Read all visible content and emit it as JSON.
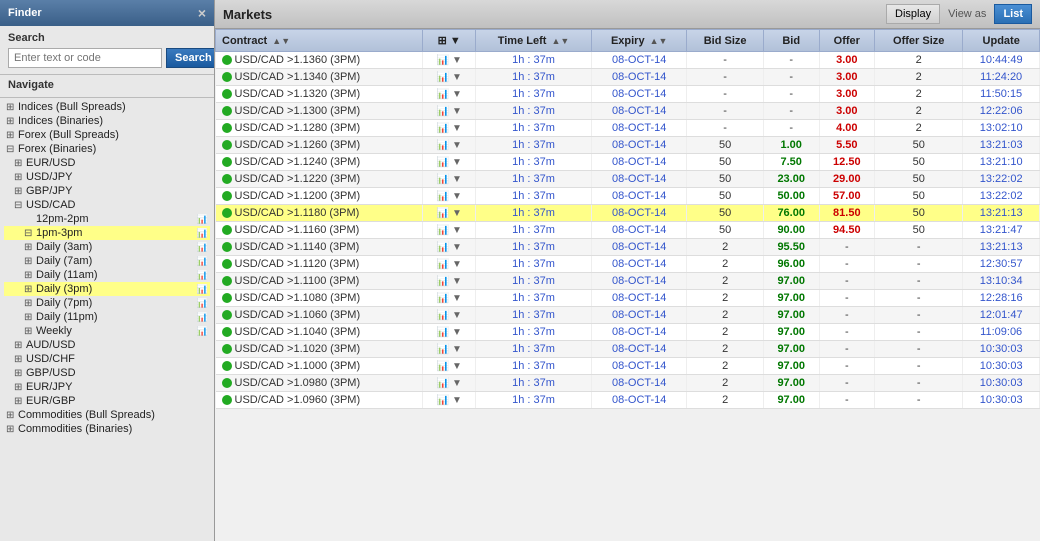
{
  "sidebar": {
    "title": "Finder",
    "close_button": "×",
    "search": {
      "label": "Search",
      "placeholder": "Enter text or code",
      "button_label": "Search"
    },
    "navigate_label": "Navigate",
    "nav_items": [
      {
        "id": "indices-bull",
        "label": "Indices (Bull Spreads)",
        "level": 0,
        "expanded": false,
        "expandable": true
      },
      {
        "id": "indices-bin",
        "label": "Indices (Binaries)",
        "level": 0,
        "expanded": false,
        "expandable": true
      },
      {
        "id": "forex-bull",
        "label": "Forex (Bull Spreads)",
        "level": 0,
        "expanded": false,
        "expandable": true
      },
      {
        "id": "forex-bin",
        "label": "Forex (Binaries)",
        "level": 0,
        "expanded": true,
        "expandable": true
      },
      {
        "id": "eur-usd",
        "label": "EUR/USD",
        "level": 1,
        "expanded": false,
        "expandable": true
      },
      {
        "id": "usd-jpy",
        "label": "USD/JPY",
        "level": 1,
        "expanded": false,
        "expandable": true
      },
      {
        "id": "gbp-jpy",
        "label": "GBP/JPY",
        "level": 1,
        "expanded": false,
        "expandable": true
      },
      {
        "id": "usd-cad",
        "label": "USD/CAD",
        "level": 1,
        "expanded": true,
        "expandable": true
      },
      {
        "id": "12pm-2pm",
        "label": "12pm-2pm",
        "level": 2,
        "expanded": false,
        "expandable": false,
        "has_icon": true
      },
      {
        "id": "1pm-3pm",
        "label": "1pm-3pm",
        "level": 2,
        "expanded": true,
        "expandable": true,
        "has_icon": true,
        "active": true
      },
      {
        "id": "daily-3am",
        "label": "Daily (3am)",
        "level": 2,
        "expanded": false,
        "expandable": true,
        "has_icon": true
      },
      {
        "id": "daily-7am",
        "label": "Daily (7am)",
        "level": 2,
        "expanded": false,
        "expandable": true,
        "has_icon": true
      },
      {
        "id": "daily-11am",
        "label": "Daily (11am)",
        "level": 2,
        "expanded": false,
        "expandable": true,
        "has_icon": true
      },
      {
        "id": "daily-3pm",
        "label": "Daily (3pm)",
        "level": 2,
        "expanded": false,
        "expandable": true,
        "has_icon": true,
        "active": true
      },
      {
        "id": "daily-7pm",
        "label": "Daily (7pm)",
        "level": 2,
        "expanded": false,
        "expandable": true,
        "has_icon": true
      },
      {
        "id": "daily-11pm",
        "label": "Daily (11pm)",
        "level": 2,
        "expanded": false,
        "expandable": true,
        "has_icon": true
      },
      {
        "id": "weekly",
        "label": "Weekly",
        "level": 2,
        "expanded": false,
        "expandable": true,
        "has_icon": true
      },
      {
        "id": "aud-usd",
        "label": "AUD/USD",
        "level": 1,
        "expanded": false,
        "expandable": true
      },
      {
        "id": "usd-chf",
        "label": "USD/CHF",
        "level": 1,
        "expanded": false,
        "expandable": true
      },
      {
        "id": "gbp-usd",
        "label": "GBP/USD",
        "level": 1,
        "expanded": false,
        "expandable": true
      },
      {
        "id": "eur-jpy",
        "label": "EUR/JPY",
        "level": 1,
        "expanded": false,
        "expandable": true
      },
      {
        "id": "eur-gbp",
        "label": "EUR/GBP",
        "level": 1,
        "expanded": false,
        "expandable": true
      },
      {
        "id": "commodities-bull",
        "label": "Commodities (Bull Spreads)",
        "level": 0,
        "expanded": false,
        "expandable": true
      },
      {
        "id": "commodities-bin",
        "label": "Commodities (Binaries)",
        "level": 0,
        "expanded": false,
        "expandable": true
      }
    ]
  },
  "main": {
    "title": "Markets",
    "display_button": "Display",
    "viewas_label": "View as",
    "list_button": "List",
    "table": {
      "columns": [
        {
          "id": "contract",
          "label": "Contract",
          "sortable": true
        },
        {
          "id": "icons",
          "label": "",
          "sortable": false
        },
        {
          "id": "time_left",
          "label": "Time Left",
          "sortable": true
        },
        {
          "id": "expiry",
          "label": "Expiry",
          "sortable": true
        },
        {
          "id": "bid_size",
          "label": "Bid Size",
          "sortable": false
        },
        {
          "id": "bid",
          "label": "Bid",
          "sortable": false
        },
        {
          "id": "offer",
          "label": "Offer",
          "sortable": false
        },
        {
          "id": "offer_size",
          "label": "Offer Size",
          "sortable": false
        },
        {
          "id": "update",
          "label": "Update",
          "sortable": false
        }
      ],
      "rows": [
        {
          "contract": "USD/CAD >1.1360 (3PM)",
          "time_left": "1h : 37m",
          "expiry": "08-OCT-14",
          "bid_size": "-",
          "bid": "-",
          "offer": "3.00",
          "offer_size": "2",
          "update": "10:44:49",
          "highlighted": false,
          "pinkish": false
        },
        {
          "contract": "USD/CAD >1.1340 (3PM)",
          "time_left": "1h : 37m",
          "expiry": "08-OCT-14",
          "bid_size": "-",
          "bid": "-",
          "offer": "3.00",
          "offer_size": "2",
          "update": "11:24:20",
          "highlighted": false,
          "pinkish": false
        },
        {
          "contract": "USD/CAD >1.1320 (3PM)",
          "time_left": "1h : 37m",
          "expiry": "08-OCT-14",
          "bid_size": "-",
          "bid": "-",
          "offer": "3.00",
          "offer_size": "2",
          "update": "11:50:15",
          "highlighted": false,
          "pinkish": false
        },
        {
          "contract": "USD/CAD >1.1300 (3PM)",
          "time_left": "1h : 37m",
          "expiry": "08-OCT-14",
          "bid_size": "-",
          "bid": "-",
          "offer": "3.00",
          "offer_size": "2",
          "update": "12:22:06",
          "highlighted": false,
          "pinkish": false
        },
        {
          "contract": "USD/CAD >1.1280 (3PM)",
          "time_left": "1h : 37m",
          "expiry": "08-OCT-14",
          "bid_size": "-",
          "bid": "-",
          "offer": "4.00",
          "offer_size": "2",
          "update": "13:02:10",
          "highlighted": false,
          "pinkish": false
        },
        {
          "contract": "USD/CAD >1.1260 (3PM)",
          "time_left": "1h : 37m",
          "expiry": "08-OCT-14",
          "bid_size": "50",
          "bid": "1.00",
          "offer": "5.50",
          "offer_size": "50",
          "update": "13:21:03",
          "highlighted": false,
          "pinkish": false
        },
        {
          "contract": "USD/CAD >1.1240 (3PM)",
          "time_left": "1h : 37m",
          "expiry": "08-OCT-14",
          "bid_size": "50",
          "bid": "7.50",
          "offer": "12.50",
          "offer_size": "50",
          "update": "13:21:10",
          "highlighted": false,
          "pinkish": false
        },
        {
          "contract": "USD/CAD >1.1220 (3PM)",
          "time_left": "1h : 37m",
          "expiry": "08-OCT-14",
          "bid_size": "50",
          "bid": "23.00",
          "offer": "29.00",
          "offer_size": "50",
          "update": "13:22:02",
          "highlighted": false,
          "pinkish": false
        },
        {
          "contract": "USD/CAD >1.1200 (3PM)",
          "time_left": "1h : 37m",
          "expiry": "08-OCT-14",
          "bid_size": "50",
          "bid": "50.00",
          "offer": "57.00",
          "offer_size": "50",
          "update": "13:22:02",
          "highlighted": false,
          "pinkish": false
        },
        {
          "contract": "USD/CAD >1.1180 (3PM)",
          "time_left": "1h : 37m",
          "expiry": "08-OCT-14",
          "bid_size": "50",
          "bid": "76.00",
          "offer": "81.50",
          "offer_size": "50",
          "update": "13:21:13",
          "highlighted": true,
          "pinkish": false
        },
        {
          "contract": "USD/CAD >1.1160 (3PM)",
          "time_left": "1h : 37m",
          "expiry": "08-OCT-14",
          "bid_size": "50",
          "bid": "90.00",
          "offer": "94.50",
          "offer_size": "50",
          "update": "13:21:47",
          "highlighted": false,
          "pinkish": false
        },
        {
          "contract": "USD/CAD >1.1140 (3PM)",
          "time_left": "1h : 37m",
          "expiry": "08-OCT-14",
          "bid_size": "2",
          "bid": "95.50",
          "offer": "-",
          "offer_size": "-",
          "update": "13:21:13",
          "highlighted": false,
          "pinkish": false
        },
        {
          "contract": "USD/CAD >1.1120 (3PM)",
          "time_left": "1h : 37m",
          "expiry": "08-OCT-14",
          "bid_size": "2",
          "bid": "96.00",
          "offer": "-",
          "offer_size": "-",
          "update": "12:30:57",
          "highlighted": false,
          "pinkish": false
        },
        {
          "contract": "USD/CAD >1.1100 (3PM)",
          "time_left": "1h : 37m",
          "expiry": "08-OCT-14",
          "bid_size": "2",
          "bid": "97.00",
          "offer": "-",
          "offer_size": "-",
          "update": "13:10:34",
          "highlighted": false,
          "pinkish": false
        },
        {
          "contract": "USD/CAD >1.1080 (3PM)",
          "time_left": "1h : 37m",
          "expiry": "08-OCT-14",
          "bid_size": "2",
          "bid": "97.00",
          "offer": "-",
          "offer_size": "-",
          "update": "12:28:16",
          "highlighted": false,
          "pinkish": false
        },
        {
          "contract": "USD/CAD >1.1060 (3PM)",
          "time_left": "1h : 37m",
          "expiry": "08-OCT-14",
          "bid_size": "2",
          "bid": "97.00",
          "offer": "-",
          "offer_size": "-",
          "update": "12:01:47",
          "highlighted": false,
          "pinkish": false
        },
        {
          "contract": "USD/CAD >1.1040 (3PM)",
          "time_left": "1h : 37m",
          "expiry": "08-OCT-14",
          "bid_size": "2",
          "bid": "97.00",
          "offer": "-",
          "offer_size": "-",
          "update": "11:09:06",
          "highlighted": false,
          "pinkish": false
        },
        {
          "contract": "USD/CAD >1.1020 (3PM)",
          "time_left": "1h : 37m",
          "expiry": "08-OCT-14",
          "bid_size": "2",
          "bid": "97.00",
          "offer": "-",
          "offer_size": "-",
          "update": "10:30:03",
          "highlighted": false,
          "pinkish": false
        },
        {
          "contract": "USD/CAD >1.1000 (3PM)",
          "time_left": "1h : 37m",
          "expiry": "08-OCT-14",
          "bid_size": "2",
          "bid": "97.00",
          "offer": "-",
          "offer_size": "-",
          "update": "10:30:03",
          "highlighted": false,
          "pinkish": false
        },
        {
          "contract": "USD/CAD >1.0980 (3PM)",
          "time_left": "1h : 37m",
          "expiry": "08-OCT-14",
          "bid_size": "2",
          "bid": "97.00",
          "offer": "-",
          "offer_size": "-",
          "update": "10:30:03",
          "highlighted": false,
          "pinkish": false
        },
        {
          "contract": "USD/CAD >1.0960 (3PM)",
          "time_left": "1h : 37m",
          "expiry": "08-OCT-14",
          "bid_size": "2",
          "bid": "97.00",
          "offer": "-",
          "offer_size": "-",
          "update": "10:30:03",
          "highlighted": false,
          "pinkish": false
        }
      ]
    }
  }
}
